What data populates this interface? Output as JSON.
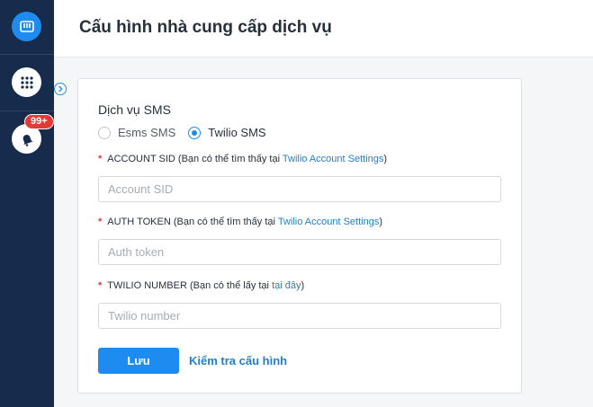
{
  "rail": {
    "brand_icon": "app-logo-icon",
    "apps_icon": "apps-grid-icon",
    "notify_icon": "bell-icon",
    "notification_badge": "99+"
  },
  "header": {
    "title": "Cấu hình nhà cung cấp dịch vụ"
  },
  "sms": {
    "title": "Dịch vụ SMS",
    "options": [
      {
        "label": "Esms SMS",
        "selected": false
      },
      {
        "label": "Twilio SMS",
        "selected": true
      }
    ]
  },
  "fields": {
    "account_sid": {
      "label": "ACCOUNT SID (Bạn có thể tìm thấy tại ",
      "link": "Twilio Account Settings",
      "suffix": ")",
      "placeholder": "Account SID",
      "value": ""
    },
    "auth_token": {
      "label": "AUTH TOKEN (Bạn có thể tìm thấy tại ",
      "link": "Twilio Account Settings",
      "suffix": ")",
      "placeholder": "Auth token",
      "value": ""
    },
    "twilio_number": {
      "label": "TWILIO NUMBER (Bạn có thể lấy tại ",
      "link": "tại đây",
      "suffix": ")",
      "placeholder": "Twilio number",
      "value": ""
    }
  },
  "actions": {
    "save": "Lưu",
    "check": "Kiểm tra cấu hình"
  },
  "colors": {
    "accent": "#1e8bf0",
    "rail": "#172b4d",
    "required": "#e53935"
  }
}
